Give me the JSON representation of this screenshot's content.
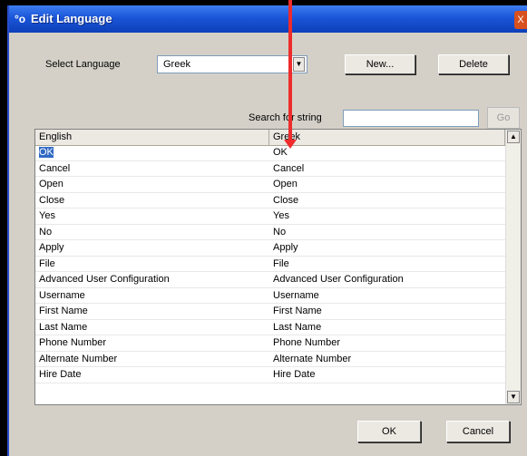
{
  "window": {
    "title": "Edit Language",
    "icon": "language-icon",
    "close_label": "X"
  },
  "select": {
    "label": "Select Language",
    "value": "Greek"
  },
  "buttons": {
    "new": "New...",
    "delete": "Delete",
    "go": "Go",
    "ok": "OK",
    "cancel": "Cancel"
  },
  "search": {
    "label": "Search for string",
    "value": ""
  },
  "table": {
    "columns": [
      "English",
      "Greek"
    ],
    "rows": [
      [
        "OK",
        "OK"
      ],
      [
        "Cancel",
        "Cancel"
      ],
      [
        "Open",
        "Open"
      ],
      [
        "Close",
        "Close"
      ],
      [
        "Yes",
        "Yes"
      ],
      [
        "No",
        "No"
      ],
      [
        "Apply",
        "Apply"
      ],
      [
        "File",
        "File"
      ],
      [
        "Advanced User Configuration",
        "Advanced User Configuration"
      ],
      [
        "Username",
        "Username"
      ],
      [
        "First Name",
        "First Name"
      ],
      [
        "Last Name",
        "Last Name"
      ],
      [
        "Phone Number",
        "Phone Number"
      ],
      [
        "Alternate Number",
        "Alternate Number"
      ],
      [
        "Hire Date",
        "Hire Date"
      ]
    ]
  },
  "colors": {
    "titlebar": "#1a55d8",
    "selection": "#316ac5",
    "annotation_arrow": "#ee2c2c"
  }
}
